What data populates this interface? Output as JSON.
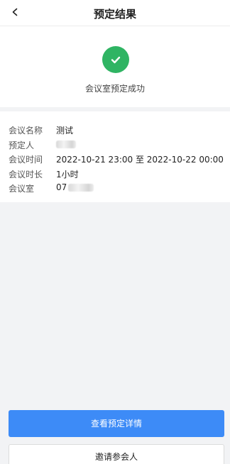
{
  "header": {
    "title": "预定结果",
    "back_icon": "chevron-left-icon"
  },
  "status": {
    "icon": "check-circle-icon",
    "color": "#2fb463",
    "message": "会议室预定成功"
  },
  "details": [
    {
      "label": "会议名称",
      "value": "测试"
    },
    {
      "label": "预定人",
      "value": ""
    },
    {
      "label": "会议时间",
      "value": "2022-10-21 23:00 至 2022-10-22 00:00"
    },
    {
      "label": "会议时长",
      "value": "1小时"
    },
    {
      "label": "会议室",
      "value": "07"
    }
  ],
  "actions": {
    "primary_label": "查看预定详情",
    "secondary_label": "邀请参会人",
    "primary_color": "#3d8bf7"
  }
}
